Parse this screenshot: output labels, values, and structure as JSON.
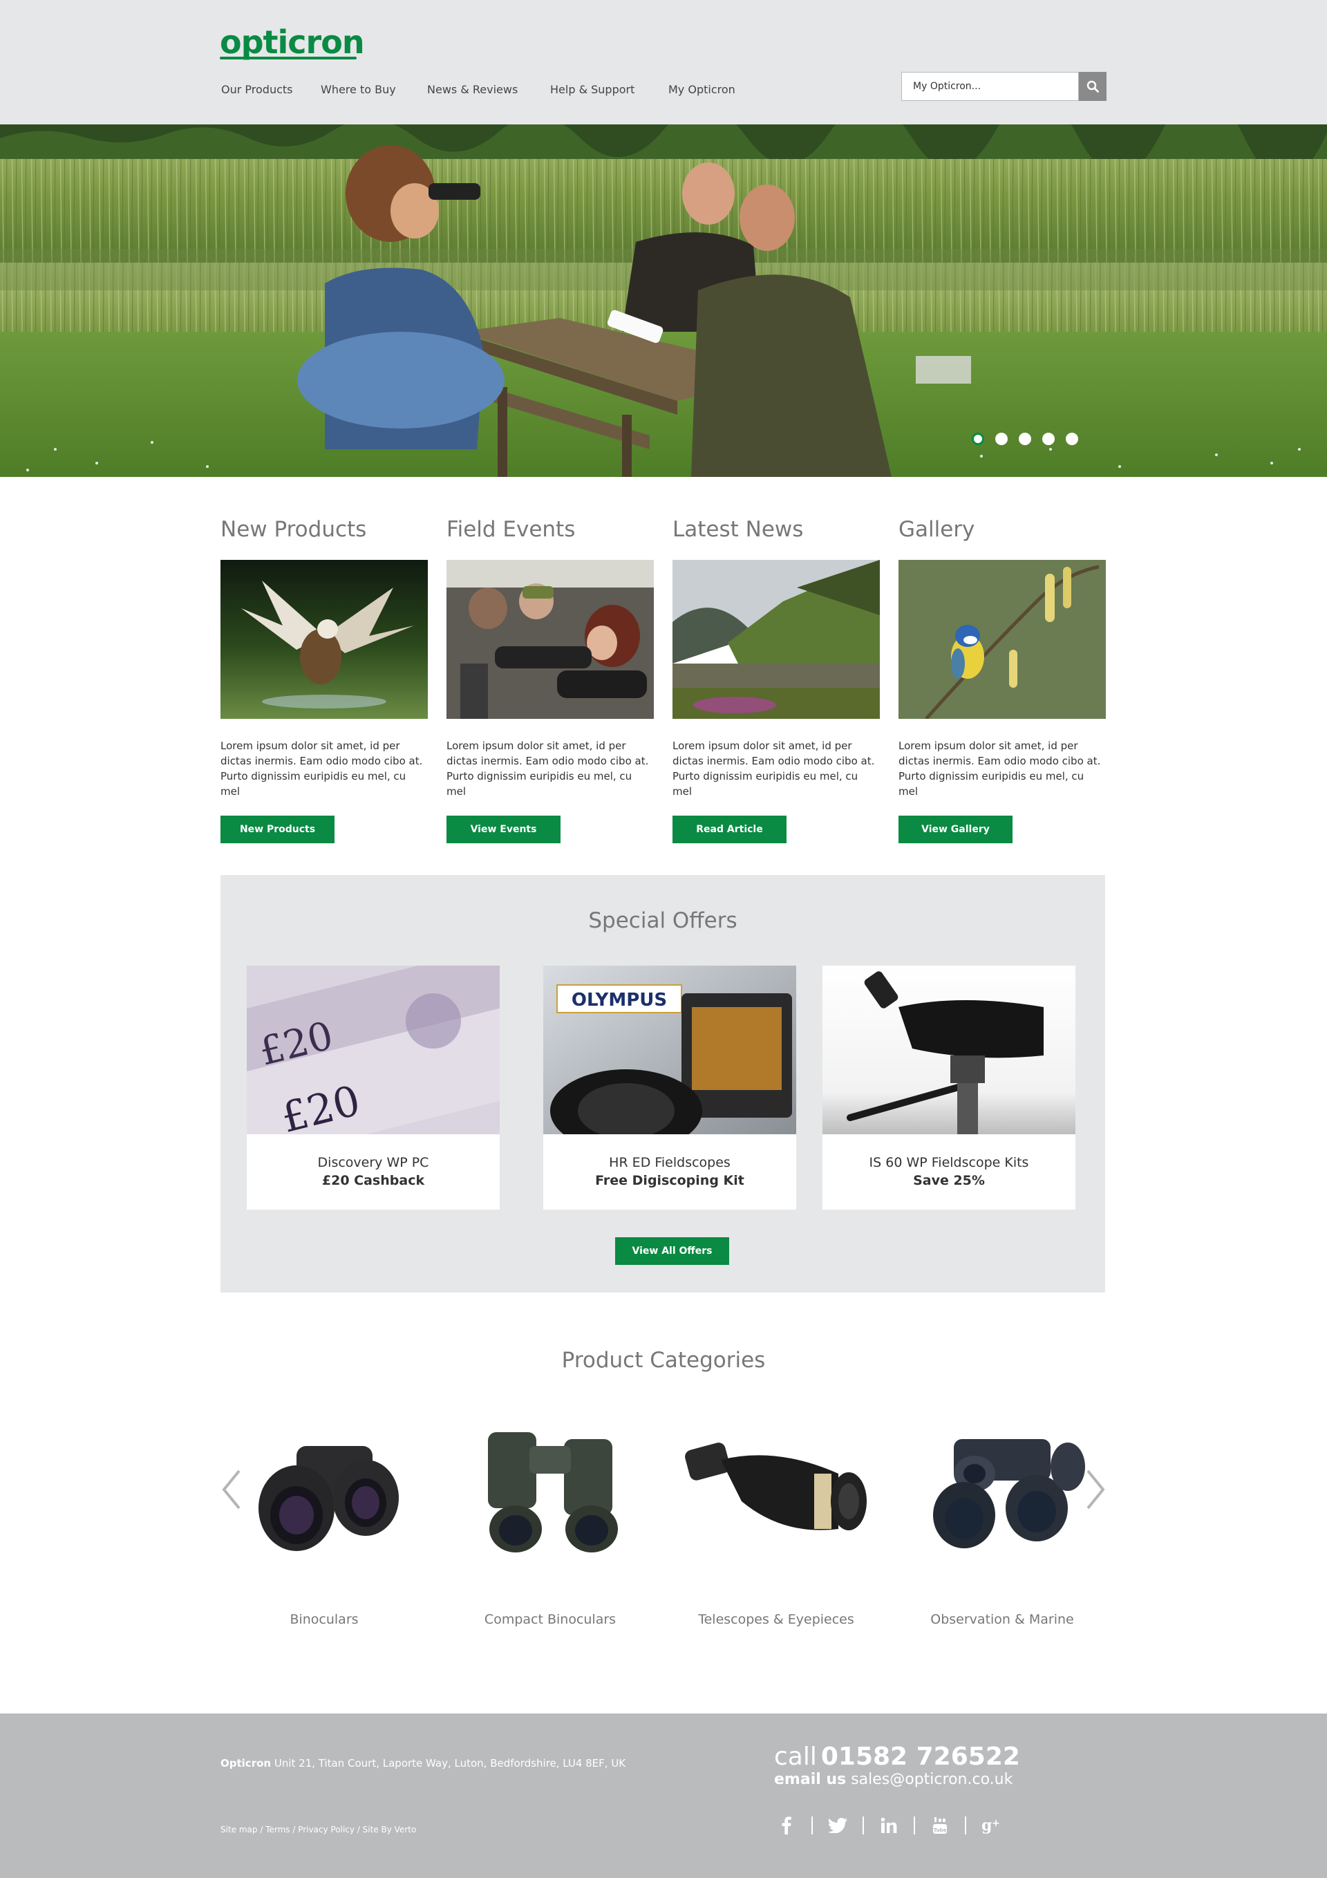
{
  "brand": {
    "logo_text": "opticron",
    "color": "#0a8a43"
  },
  "nav": {
    "items": [
      {
        "label": "Our Products"
      },
      {
        "label": "Where to Buy"
      },
      {
        "label": "News & Reviews"
      },
      {
        "label": "Help & Support"
      },
      {
        "label": "My Opticron"
      }
    ]
  },
  "search": {
    "placeholder": "My Opticron...",
    "icon": "search-icon"
  },
  "hero": {
    "slide_count": 5,
    "active_slide": 1
  },
  "features": [
    {
      "title": "New Products",
      "text": "Lorem ipsum dolor sit amet, id per dictas inermis. Eam odio modo cibo at. Purto dignissim euripidis eu mel, cu mel",
      "button": "New Products"
    },
    {
      "title": "Field Events",
      "text": "Lorem ipsum dolor sit amet, id per dictas inermis. Eam odio modo cibo at. Purto dignissim euripidis eu mel, cu mel",
      "button": "View Events"
    },
    {
      "title": "Latest News",
      "text": "Lorem ipsum dolor sit amet, id per dictas inermis. Eam odio modo cibo at. Purto dignissim euripidis eu mel, cu mel",
      "button": "Read Article"
    },
    {
      "title": "Gallery",
      "text": "Lorem ipsum dolor sit amet, id per dictas inermis. Eam odio modo cibo at. Purto dignissim euripidis eu mel, cu mel",
      "button": "View Gallery"
    }
  ],
  "offers": {
    "title": "Special Offers",
    "items": [
      {
        "name": "Discovery WP PC",
        "deal": "£20 Cashback"
      },
      {
        "name": "HR ED Fieldscopes",
        "deal": "Free Digiscoping Kit",
        "brand_label": "OLYMPUS"
      },
      {
        "name": "IS 60 WP Fieldscope Kits",
        "deal": "Save 25%"
      }
    ],
    "view_all": "View All Offers"
  },
  "categories": {
    "title": "Product Categories",
    "items": [
      {
        "label": "Binoculars"
      },
      {
        "label": "Compact Binoculars"
      },
      {
        "label": "Telescopes & Eyepieces"
      },
      {
        "label": "Observation & Marine"
      }
    ]
  },
  "footer": {
    "company": "Opticron",
    "address": "Unit 21, Titan Court, Laporte Way, Luton, Bedfordshire, LU4 8EF, UK",
    "links": [
      "Site map",
      "Terms",
      "Privacy Policy",
      "Site By Verto"
    ],
    "call_label": "call",
    "phone": "01582 726522",
    "email_label": "email us",
    "email": "sales@opticron.co.uk",
    "social": [
      "facebook-icon",
      "twitter-icon",
      "linkedin-icon",
      "youtube-icon",
      "google-plus-icon"
    ]
  }
}
